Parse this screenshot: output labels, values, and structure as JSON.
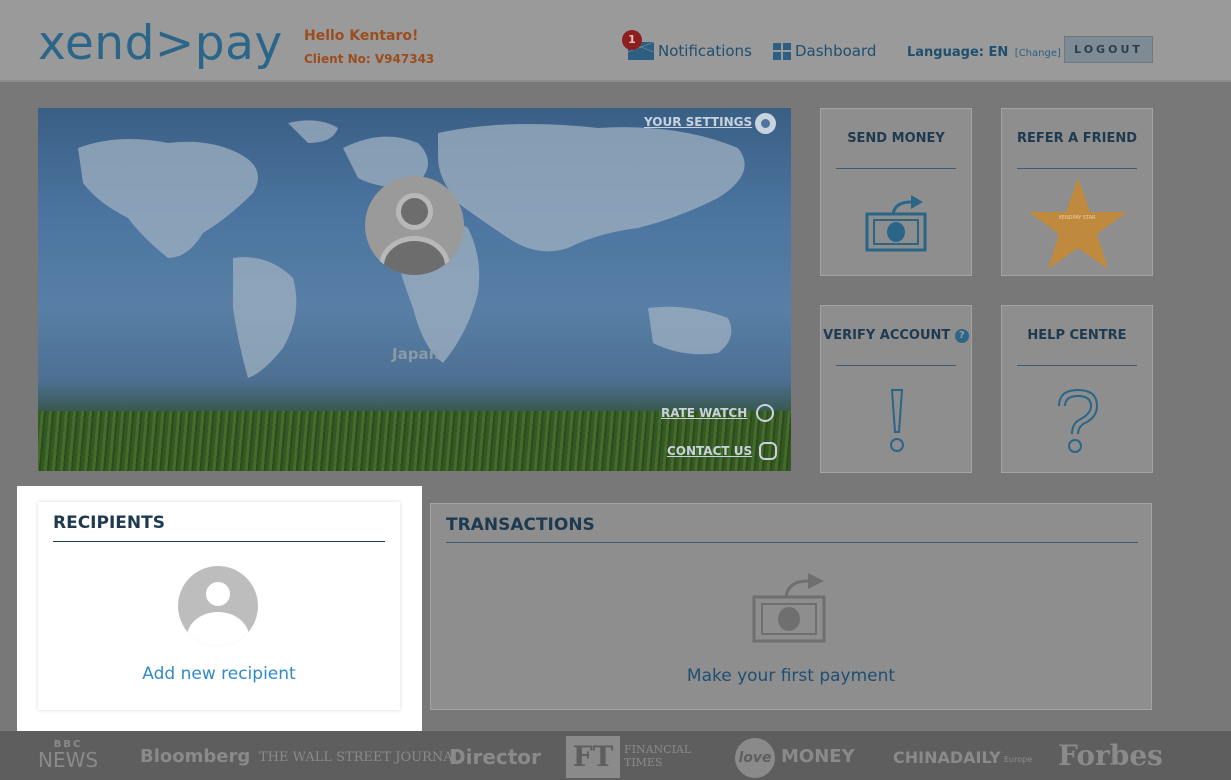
{
  "header": {
    "logo": "xend>pay",
    "greeting": "Hello Kentaro!",
    "client_no": "Client No: V947343",
    "notifications_label": "Notifications",
    "notifications_count": "1",
    "dashboard_label": "Dashboard",
    "language_label": "Language: EN",
    "language_change": "[Change]",
    "logout_label": "LOGOUT"
  },
  "hero": {
    "your_settings": "YOUR SETTINGS",
    "country": "Japan",
    "rate_watch": "RATE WATCH",
    "contact_us": "CONTACT US"
  },
  "tiles": {
    "send_money": "SEND MONEY",
    "refer_friend": "REFER A FRIEND",
    "star_text": "XENDPAY STAR",
    "verify_account": "VERIFY ACCOUNT",
    "help_centre": "HELP CENTRE"
  },
  "recipients": {
    "title": "RECIPIENTS",
    "add_label": "Add new recipient"
  },
  "transactions": {
    "title": "TRANSACTIONS",
    "first_payment": "Make your first payment"
  },
  "press": {
    "bbc_top": "BBC",
    "bbc_bottom": "NEWS",
    "bloomberg": "Bloomberg",
    "wsj": "THE WALL STREET JOURNAL.",
    "director": "Director",
    "ft_logo": "FT",
    "ft_line1": "FINANCIAL",
    "ft_line2": "TIMES",
    "lovemoney_love": "love",
    "lovemoney_money": "MONEY",
    "chinadaily": "CHINADAILY",
    "chinadaily_sub": "Europe",
    "forbes": "Forbes"
  },
  "colors": {
    "brand": "#2b6688",
    "greeting": "#9b4d1e",
    "link_blue": "#2f8ac6",
    "star": "#c08a3e"
  }
}
